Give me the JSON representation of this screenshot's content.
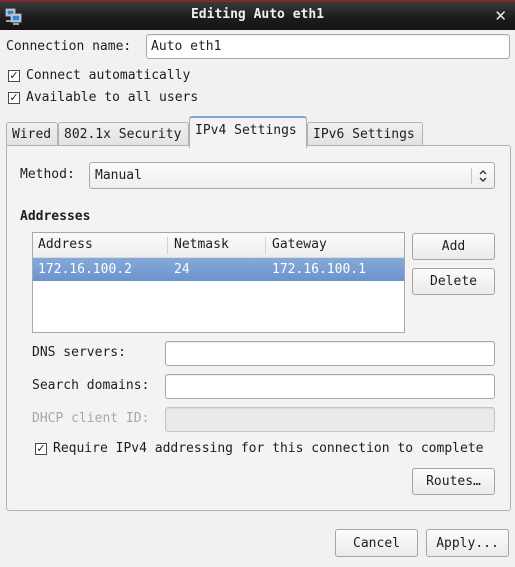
{
  "window": {
    "title": "Editing Auto eth1",
    "app_icon": "network-computers-icon",
    "close_icon": "close-icon",
    "colors": {
      "titlebar": "#1b1b1b",
      "accent": "#7fa6d6",
      "selection": "#7a9fd3"
    }
  },
  "connection": {
    "name_label": "Connection name:",
    "name_value": "Auto eth1",
    "connect_automatically": {
      "label": "Connect automatically",
      "checked": true
    },
    "available_all_users": {
      "label": "Available to all users",
      "checked": true
    }
  },
  "tabs": [
    {
      "label": "Wired",
      "active": false
    },
    {
      "label": "802.1x Security",
      "active": false
    },
    {
      "label": "IPv4 Settings",
      "active": true
    },
    {
      "label": "IPv6 Settings",
      "active": false
    }
  ],
  "ipv4": {
    "method_label": "Method:",
    "method_value": "Manual",
    "addresses_title": "Addresses",
    "columns": [
      "Address",
      "Netmask",
      "Gateway"
    ],
    "rows": [
      {
        "address": "172.16.100.2",
        "netmask": "24",
        "gateway": "172.16.100.1",
        "selected": true
      }
    ],
    "add_label": "Add",
    "delete_label": "Delete",
    "dns_label": "DNS servers:",
    "dns_value": "",
    "search_label": "Search domains:",
    "search_value": "",
    "dhcp_label": "DHCP client ID:",
    "dhcp_value": "",
    "require_ipv4": {
      "label": "Require IPv4 addressing for this connection to complete",
      "checked": true
    },
    "routes_label": "Routes…"
  },
  "footer": {
    "cancel_label": "Cancel",
    "apply_label": "Apply..."
  }
}
